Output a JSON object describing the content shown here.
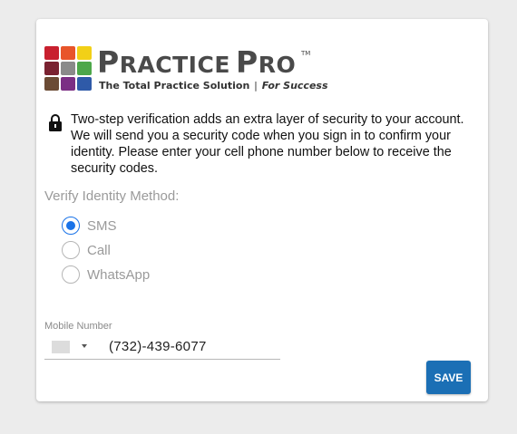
{
  "brand": {
    "name_first_initial": "P",
    "name_first_rest": "RACTICE",
    "name_second_initial": "P",
    "name_second_rest": "RO",
    "trademark": "TM",
    "tagline_main": "The Total Practice Solution",
    "tagline_separator": "|",
    "tagline_emphasis": "For Success",
    "grid_colors": [
      "#c8202f",
      "#e8552a",
      "#f2d017",
      "#7a2231",
      "#8a8a8a",
      "#4da74a",
      "#6b4b35",
      "#7b2f84",
      "#2f5aa8"
    ]
  },
  "info": {
    "icon": "lock-icon",
    "text": "Two-step verification adds an extra layer of security to your account. We will send you a security code when you sign in to confirm your identity. Please enter your cell phone number below to receive the security codes."
  },
  "verify": {
    "label": "Verify Identity Method:",
    "options": [
      {
        "label": "SMS",
        "checked": true
      },
      {
        "label": "Call",
        "checked": false
      },
      {
        "label": "WhatsApp",
        "checked": false
      }
    ]
  },
  "mobile": {
    "label": "Mobile Number",
    "value": "(732)-439-6077"
  },
  "actions": {
    "save_label": "SAVE"
  },
  "colors": {
    "accent": "#1a73e8",
    "button": "#1b6fb5"
  }
}
